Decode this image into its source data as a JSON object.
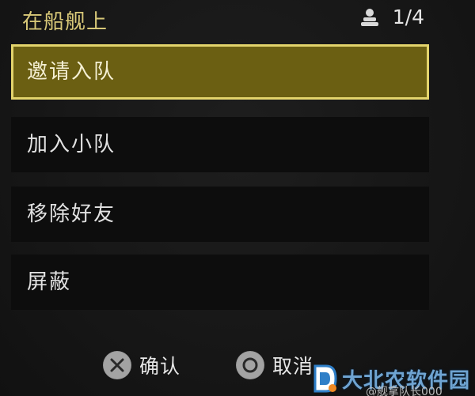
{
  "header": {
    "title": "在船舰上",
    "player_count": "1/4",
    "icon": "player-icon"
  },
  "menu": {
    "items": [
      {
        "label": "邀请入队",
        "selected": true
      },
      {
        "label": "加入小队",
        "selected": false
      },
      {
        "label": "移除好友",
        "selected": false
      },
      {
        "label": "屏蔽",
        "selected": false
      }
    ]
  },
  "footer": {
    "confirm_label": "确认",
    "cancel_label": "取消",
    "confirm_icon": "cross-button-icon",
    "cancel_icon": "circle-button-icon"
  },
  "watermark": {
    "text": "大北农软件园",
    "author": "@舰拿队长000"
  },
  "colors": {
    "accent_gold": "#e3d46c",
    "selected_fill": "#6b5f12",
    "item_bg": "#0d0d0d",
    "title_text": "#d8c878"
  }
}
